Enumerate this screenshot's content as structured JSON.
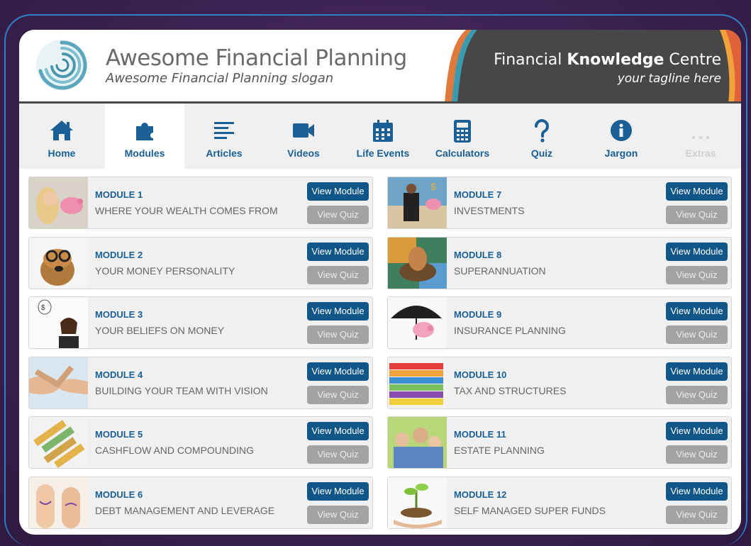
{
  "header": {
    "brand_title": "Awesome Financial Planning",
    "brand_slogan": "Awesome Financial Planning slogan",
    "fkc_title_prefix": "Financial ",
    "fkc_title_bold": "Knowledge",
    "fkc_title_suffix": " Centre",
    "fkc_tagline": "your tagline here"
  },
  "nav": {
    "items": [
      {
        "label": "Home",
        "icon": "home-icon"
      },
      {
        "label": "Modules",
        "icon": "puzzle-icon"
      },
      {
        "label": "Articles",
        "icon": "articles-icon"
      },
      {
        "label": "Videos",
        "icon": "video-camera-icon"
      },
      {
        "label": "Life Events",
        "icon": "calendar-icon"
      },
      {
        "label": "Calculators",
        "icon": "calculator-icon"
      },
      {
        "label": "Quiz",
        "icon": "question-icon"
      },
      {
        "label": "Jargon",
        "icon": "info-icon"
      },
      {
        "label": "Extras",
        "icon": "more-dots-icon"
      }
    ],
    "active": "Modules"
  },
  "modules": [
    {
      "number": "MODULE 1",
      "title": "WHERE YOUR WEALTH COMES FROM",
      "view_module": "View Module",
      "view_quiz": "View Quiz"
    },
    {
      "number": "MODULE 2",
      "title": "YOUR MONEY PERSONALITY",
      "view_module": "View Module",
      "view_quiz": "View Quiz"
    },
    {
      "number": "MODULE 3",
      "title": "YOUR BELIEFS ON MONEY",
      "view_module": "View Module",
      "view_quiz": "View Quiz"
    },
    {
      "number": "MODULE 4",
      "title": "BUILDING YOUR TEAM WITH VISION",
      "view_module": "View Module",
      "view_quiz": "View Quiz"
    },
    {
      "number": "MODULE 5",
      "title": "CASHFLOW AND COMPOUNDING",
      "view_module": "View Module",
      "view_quiz": "View Quiz"
    },
    {
      "number": "MODULE 6",
      "title": "DEBT MANAGEMENT AND LEVERAGE",
      "view_module": "View Module",
      "view_quiz": "View Quiz"
    },
    {
      "number": "MODULE 7",
      "title": "INVESTMENTS",
      "view_module": "View Module",
      "view_quiz": "View Quiz"
    },
    {
      "number": "MODULE 8",
      "title": "SUPERANNUATION",
      "view_module": "View Module",
      "view_quiz": "View Quiz"
    },
    {
      "number": "MODULE 9",
      "title": "INSURANCE PLANNING",
      "view_module": "View Module",
      "view_quiz": "View Quiz"
    },
    {
      "number": "MODULE 10",
      "title": "TAX AND STRUCTURES",
      "view_module": "View Module",
      "view_quiz": "View Quiz"
    },
    {
      "number": "MODULE 11",
      "title": "ESTATE PLANNING",
      "view_module": "View Module",
      "view_quiz": "View Quiz"
    },
    {
      "number": "MODULE 12",
      "title": "SELF MANAGED SUPER FUNDS",
      "view_module": "View Module",
      "view_quiz": "View Quiz"
    }
  ],
  "colors": {
    "accent": "#1a5f96",
    "button_primary": "#105689",
    "button_secondary": "#a3a3a3",
    "page_background": "#3d2350",
    "frame_line": "#2f7fc9"
  }
}
